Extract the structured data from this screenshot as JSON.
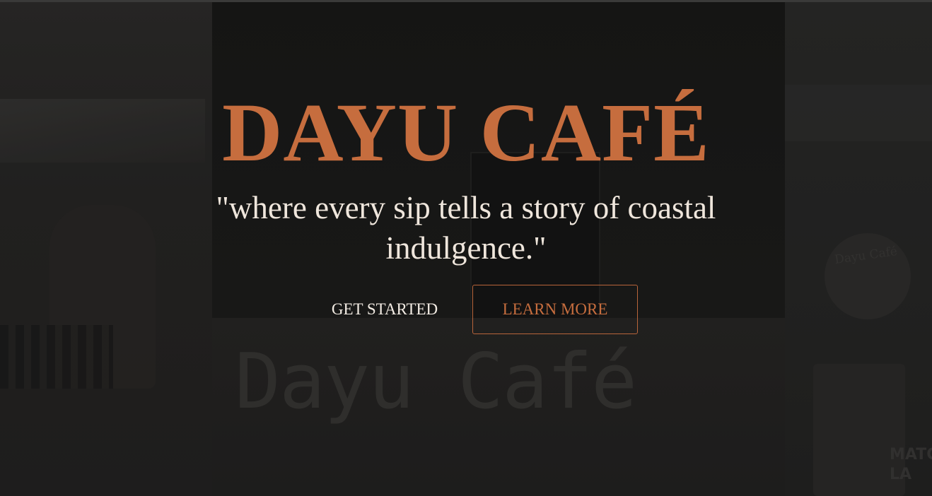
{
  "hero": {
    "title": "DAYU CAFÉ",
    "tagline": "\"where every sip tells a story of coastal indulgence.\"",
    "primary_button": "GET STARTED",
    "secondary_button": "LEARN MORE"
  },
  "background": {
    "stall_sign": "Dayu Café",
    "logo_text": "Dayu Café",
    "side_text": "MATC\nLA"
  },
  "colors": {
    "accent": "#c66d3e",
    "tagline": "#efe6dc",
    "background": "#1e1d1c"
  }
}
